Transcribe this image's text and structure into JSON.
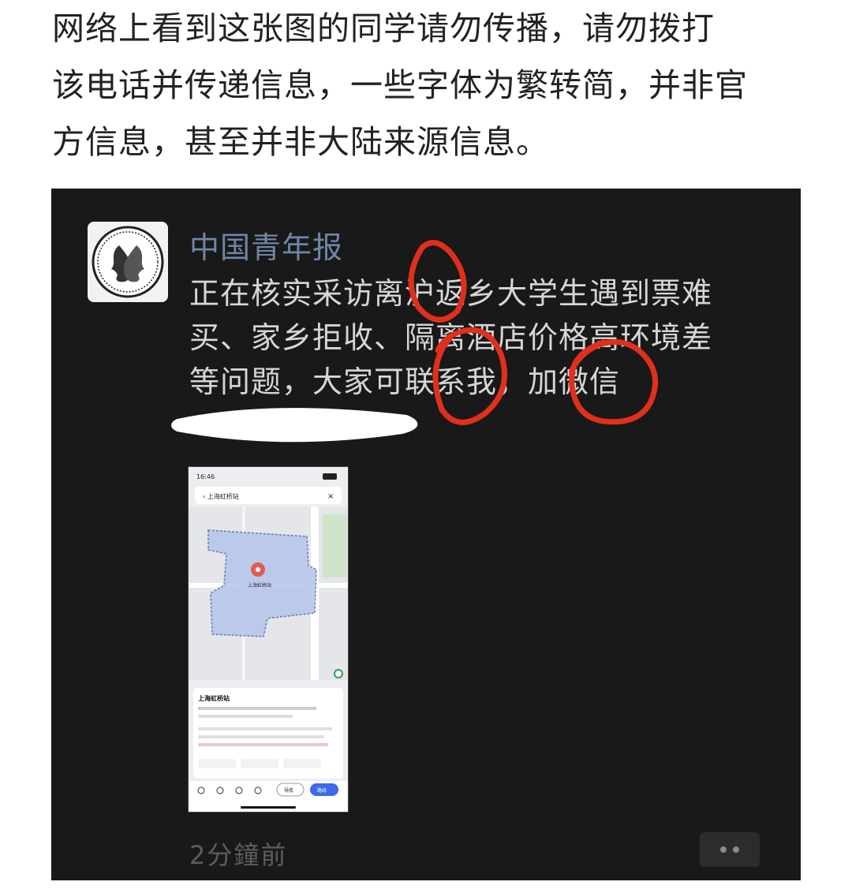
{
  "intro": {
    "lines": [
      "网络上看到这张图的同学请勿传播，请勿拨打",
      "该电话并传递信息，一些字体为繁转简，并非官",
      "方信息，甚至并非大陆来源信息。"
    ]
  },
  "post": {
    "account_name": "中国青年报",
    "text_lines": [
      "正在核实采访离沪返乡大学生遇到票难",
      "买、家乡拒收、隔离酒店价格高环境差",
      "等问题，大家可联系我，加微信"
    ],
    "time": "2分鐘前",
    "phone": {
      "status_time": "16:46",
      "search": "上海虹桥站",
      "place_marker": "上海虹桥站",
      "place_title": "上海虹桥站",
      "nav_primary": "路线",
      "nav_secondary": "导航"
    }
  },
  "colors": {
    "background": "#ffffff",
    "post_bg": "#191919",
    "account_name": "#6f86a8",
    "post_text": "#d6d6d6",
    "annotation_red": "#e0301c",
    "scribble_white": "#ffffff"
  },
  "icons": {
    "avatar": "coin-portrait-icon",
    "more": "more-dots-icon"
  }
}
